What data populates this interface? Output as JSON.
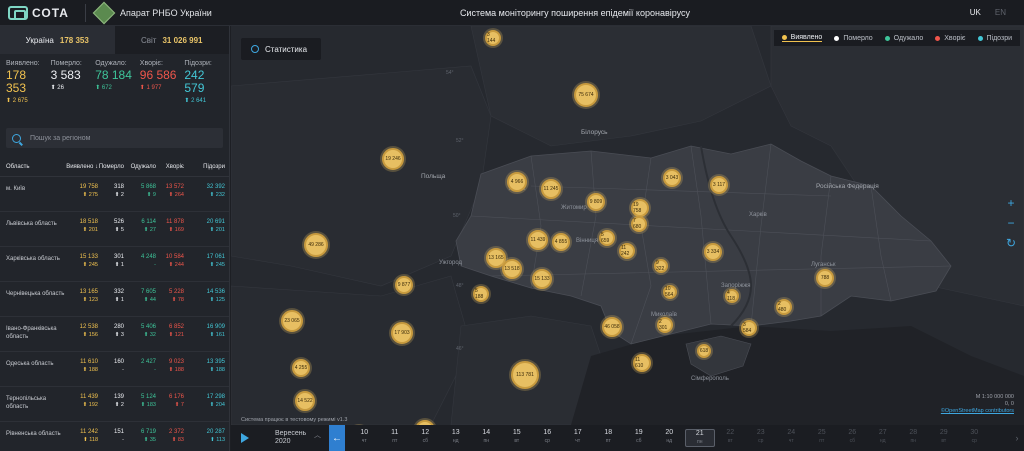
{
  "header": {
    "logo": "СОТА",
    "org": "Апарат РНБО України",
    "title": "Система моніторингу поширення епідемії коронавірусу",
    "lang_active": "UK",
    "lang_other": "EN"
  },
  "scope": {
    "ukraine_label": "Україна",
    "ukraine_value": "178 353",
    "world_label": "Світ",
    "world_value": "31 026 991"
  },
  "totals": [
    {
      "label": "Виявлено:",
      "value": "178 353",
      "delta": "⬆ 2 675",
      "color": "c-yel"
    },
    {
      "label": "Померло:",
      "value": "3 583",
      "delta": "⬆ 26",
      "color": "c-wht"
    },
    {
      "label": "Одужало:",
      "value": "78 184",
      "delta": "⬆ 672",
      "color": "c-grn"
    },
    {
      "label": "Хворіє:",
      "value": "96 586",
      "delta": "⬆ 1 977",
      "color": "c-red"
    },
    {
      "label": "Підозри:",
      "value": "242 579",
      "delta": "⬆ 2 641",
      "color": "c-blu"
    }
  ],
  "search": {
    "placeholder": "Пошук за регіоном"
  },
  "table": {
    "headers": [
      "Область",
      "Виявлено ↓",
      "Померло",
      "Одужало",
      "Хворіє",
      "Підозри"
    ],
    "rows": [
      {
        "name": "м. Київ",
        "v": [
          "19 758",
          "318",
          "5 868",
          "13 572",
          "32 392"
        ],
        "d": [
          "⬆ 275",
          "⬆ 2",
          "⬆ 9",
          "⬆ 264",
          "⬆ 232"
        ]
      },
      {
        "name": "Львівська область",
        "v": [
          "18 518",
          "526",
          "6 114",
          "11 878",
          "20 691"
        ],
        "d": [
          "⬆ 201",
          "⬆ 5",
          "⬆ 27",
          "⬆ 169",
          "⬆ 201"
        ]
      },
      {
        "name": "Харківська область",
        "v": [
          "15 133",
          "301",
          "4 248",
          "10 584",
          "17 061"
        ],
        "d": [
          "⬆ 245",
          "⬆ 1",
          "-",
          "⬆ 244",
          "⬆ 245"
        ]
      },
      {
        "name": "Чернівецька область",
        "v": [
          "13 165",
          "332",
          "7 605",
          "5 228",
          "14 536"
        ],
        "d": [
          "⬆ 123",
          "⬆ 1",
          "⬆ 44",
          "⬆ 78",
          "⬆ 125"
        ]
      },
      {
        "name": "Івано-Франківська область",
        "v": [
          "12 538",
          "280",
          "5 406",
          "6 852",
          "16 909"
        ],
        "d": [
          "⬆ 156",
          "⬆ 3",
          "⬆ 32",
          "⬆ 121",
          "⬆ 161"
        ]
      },
      {
        "name": "Одеська область",
        "v": [
          "11 610",
          "160",
          "2 427",
          "9 023",
          "13 395"
        ],
        "d": [
          "⬆ 188",
          "-",
          "-",
          "⬆ 188",
          "⬆ 188"
        ]
      },
      {
        "name": "Тернопільська область",
        "v": [
          "11 439",
          "139",
          "5 124",
          "6 176",
          "17 298"
        ],
        "d": [
          "⬆ 192",
          "⬆ 2",
          "⬆ 183",
          "⬆ 7",
          "⬆ 204"
        ]
      },
      {
        "name": "Рівненська область",
        "v": [
          "11 242",
          "151",
          "6 719",
          "2 372",
          "20 287"
        ],
        "d": [
          "⬆ 118",
          "-",
          "⬆ 35",
          "⬆ 83",
          "⬆ 113"
        ]
      }
    ]
  },
  "map": {
    "stat_button": "Статистика",
    "legend": [
      {
        "label": "Виявлено",
        "color": "#f1c24f",
        "active": true
      },
      {
        "label": "Померло",
        "color": "#ffffff",
        "active": false
      },
      {
        "label": "Одужало",
        "color": "#3ec59a",
        "active": false
      },
      {
        "label": "Хворіє",
        "color": "#f0564b",
        "active": false
      },
      {
        "label": "Підозри",
        "color": "#43c7d6",
        "active": false
      }
    ],
    "places": [
      {
        "name": "Білорусь",
        "big": true
      },
      {
        "name": "Польща",
        "big": true
      },
      {
        "name": "Російська Федерація",
        "big": true
      },
      {
        "name": "Луцьк"
      },
      {
        "name": "Житомир"
      },
      {
        "name": "Вінниця"
      },
      {
        "name": "Ужгород"
      },
      {
        "name": "Харків"
      },
      {
        "name": "Луганськ"
      },
      {
        "name": "Запоріжжя"
      },
      {
        "name": "Миколаїв"
      },
      {
        "name": "Сімферополь"
      }
    ],
    "lat_labels": [
      "54°",
      "52°",
      "50°",
      "48°",
      "46°"
    ],
    "clusters": [
      "3 144",
      "75 674",
      "19 246",
      "4 966",
      "11 245",
      "9 809",
      "3 043",
      "3 117",
      "19 758",
      "7 680",
      "5 659",
      "13 165",
      "11 439",
      "4 855",
      "13 518",
      "15 133",
      "3 334",
      "49 286",
      "9 877",
      "5 188",
      "11 242",
      "9 322",
      "10 564",
      "4 118",
      "788",
      "2 480",
      "23 065",
      "17 903",
      "46 058",
      "2 301",
      "3 584",
      "4 255",
      "14 522",
      "113 781",
      "11 610",
      "618",
      "32 908",
      "33 439",
      "720"
    ],
    "test_note": "Система працює в тестовому режимі v1.3",
    "scale_1": "М 1:10 000 000",
    "scale_2": "0, 0",
    "osm": "©OpenStreetMap contributors",
    "zoom_in": "+",
    "zoom_out": "−",
    "refresh": "↻"
  },
  "timeline": {
    "month": "Вересень",
    "year": "2020",
    "days": [
      {
        "n": "10",
        "w": "чт"
      },
      {
        "n": "11",
        "w": "пт"
      },
      {
        "n": "12",
        "w": "сб"
      },
      {
        "n": "13",
        "w": "нд"
      },
      {
        "n": "14",
        "w": "пн"
      },
      {
        "n": "15",
        "w": "вт"
      },
      {
        "n": "16",
        "w": "ср"
      },
      {
        "n": "17",
        "w": "чт"
      },
      {
        "n": "18",
        "w": "пт"
      },
      {
        "n": "19",
        "w": "сб"
      },
      {
        "n": "20",
        "w": "нд"
      },
      {
        "n": "21",
        "w": "пн"
      },
      {
        "n": "22",
        "w": "вт"
      },
      {
        "n": "23",
        "w": "ср"
      },
      {
        "n": "24",
        "w": "чт"
      },
      {
        "n": "25",
        "w": "пт"
      },
      {
        "n": "26",
        "w": "сб"
      },
      {
        "n": "27",
        "w": "нд"
      },
      {
        "n": "28",
        "w": "пн"
      },
      {
        "n": "29",
        "w": "вт"
      },
      {
        "n": "30",
        "w": "ср"
      }
    ],
    "selected_day": "21"
  }
}
